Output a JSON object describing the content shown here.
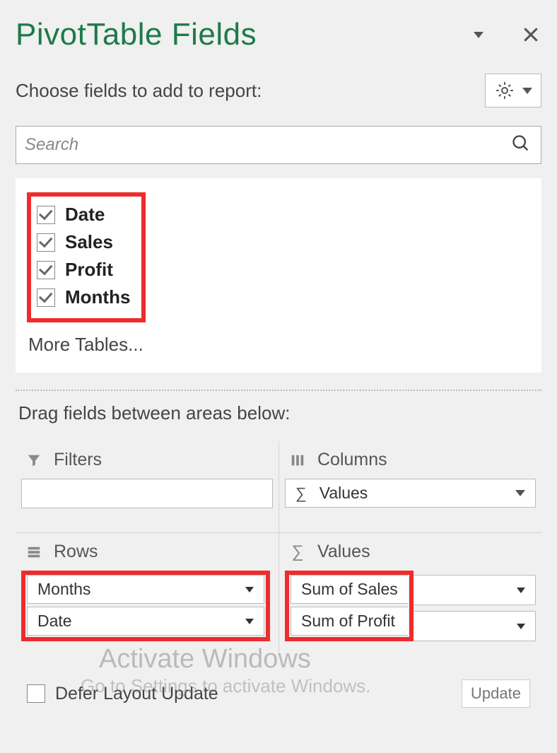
{
  "header": {
    "title": "PivotTable Fields"
  },
  "choose": {
    "label": "Choose fields to add to report:"
  },
  "search": {
    "placeholder": "Search"
  },
  "fields": [
    {
      "label": "Date",
      "checked": true
    },
    {
      "label": "Sales",
      "checked": true
    },
    {
      "label": "Profit",
      "checked": true
    },
    {
      "label": "Months",
      "checked": true
    }
  ],
  "more_tables": "More Tables...",
  "drag_label": "Drag fields between areas below:",
  "areas": {
    "filters": {
      "title": "Filters",
      "items": []
    },
    "columns": {
      "title": "Columns",
      "items": [
        {
          "label": "Values",
          "sigma": true
        }
      ]
    },
    "rows": {
      "title": "Rows",
      "items": [
        {
          "label": "Months"
        },
        {
          "label": "Date"
        }
      ]
    },
    "values": {
      "title": "Values",
      "items": [
        {
          "label": "Sum of Sales"
        },
        {
          "label": "Sum of Profit"
        }
      ]
    }
  },
  "footer": {
    "defer_label": "Defer Layout Update",
    "update_label": "Update",
    "defer_checked": false
  },
  "watermark": {
    "line1": "Activate Windows",
    "line2": "Go to Settings to activate Windows."
  }
}
